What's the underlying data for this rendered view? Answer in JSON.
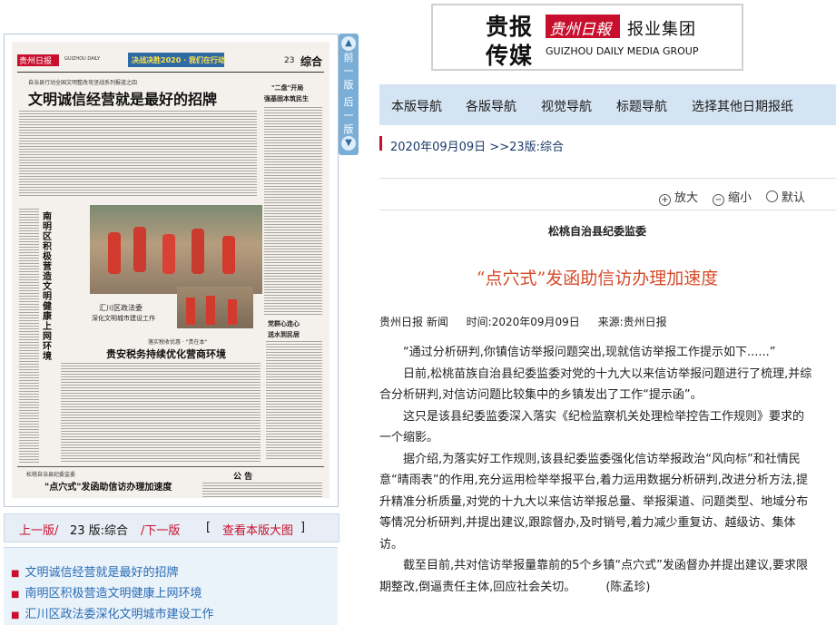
{
  "paper_thumb": {
    "masthead": "贵州日报",
    "masthead_en": "GUIZHOU DAILY",
    "banner": "决战决胜2020 · 我们在行动",
    "page_no": "23",
    "page_section": "综合",
    "kicker": "自治县行动全国文明整改攻坚战系列报道之四",
    "headline": "文明诚信经营就是最好的招牌",
    "side_head_1": "\"二盘\"开局",
    "side_head_2": "强基固本筑民生",
    "vertical_head": "南明区积极营造文明健康上网环境",
    "photo_caption_1": "汇川区政法委",
    "photo_caption_2": "深化文明城市建设工作",
    "mid_kicker": "落实税收优惠 · \"贵在本\"",
    "mid_head": "贵安税务持续优化营商环境",
    "right_box_1": "党群心连心",
    "right_box_2": "送水到民居",
    "bottom_kicker": "松桃自治县纪委监委",
    "bottom_head": "\"点穴式\"发函助信访办理加速度",
    "notice_title": "公 告"
  },
  "vbar": {
    "prev_label": "前一版",
    "next_label": "后一版"
  },
  "page_nav": {
    "prev": "上一版/",
    "current": "23 版:综合",
    "next": "/下一版",
    "bracket_l": "[",
    "view_large": "查看本版大图",
    "bracket_r": "]"
  },
  "headlines": [
    {
      "title": "文明诚信经营就是最好的招牌"
    },
    {
      "title": "南明区积极营造文明健康上网环境"
    },
    {
      "title": "汇川区政法委深化文明城市建设工作"
    }
  ],
  "logo": {
    "mark_line1": "贵报",
    "mark_line2": "传媒",
    "brand_cn": "贵州日報",
    "group_cn": "报业集团",
    "group_en": "GUIZHOU DAILY MEDIA GROUP"
  },
  "nav": [
    {
      "label": "本版导航"
    },
    {
      "label": "各版导航"
    },
    {
      "label": "视觉导航"
    },
    {
      "label": "标题导航"
    },
    {
      "label": "选择其他日期报纸"
    }
  ],
  "breadcrumb": "2020年09月09日 >>23版:综合",
  "zoom": {
    "enlarge": "放大",
    "shrink": "缩小",
    "default": "默认"
  },
  "article": {
    "kicker": "松桃自治县纪委监委",
    "title": "“点穴式”发函助信访办理加速度",
    "meta_source": "贵州日报 新闻",
    "meta_time": "时间:2020年09月09日",
    "meta_from": "来源:贵州日报",
    "paragraphs": [
      "“通过分析研判,你镇信访举报问题突出,现就信访举报工作提示如下......”",
      "日前,松桃苗族自治县纪委监委对党的十九大以来信访举报问题进行了梳理,并综合分析研判,对信访问题比较集中的乡镇发出了工作“提示函”。",
      "这只是该县纪委监委深入落实《纪检监察机关处理检举控告工作规则》要求的一个缩影。",
      "据介绍,为落实好工作规则,该县纪委监委强化信访举报政治“风向标”和社情民意“晴雨表”的作用,充分运用检举举报平台,着力运用数据分析研判,改进分析方法,提升精准分析质量,对党的十九大以来信访举报总量、举报渠道、问题类型、地域分布等情况分析研判,并提出建议,跟踪督办,及时销号,着力减少重复访、越级访、集体访。",
      "截至目前,共对信访举报量靠前的5个乡镇“点穴式”发函督办并提出建议,要求限期整改,倒逼责任主体,回应社会关切。        (陈孟珍)"
    ]
  },
  "colors": {
    "accent_red": "#c8102e",
    "title_orange": "#d64a2a",
    "nav_bg": "#d5e4f3",
    "link_blue": "#2a6db5"
  }
}
